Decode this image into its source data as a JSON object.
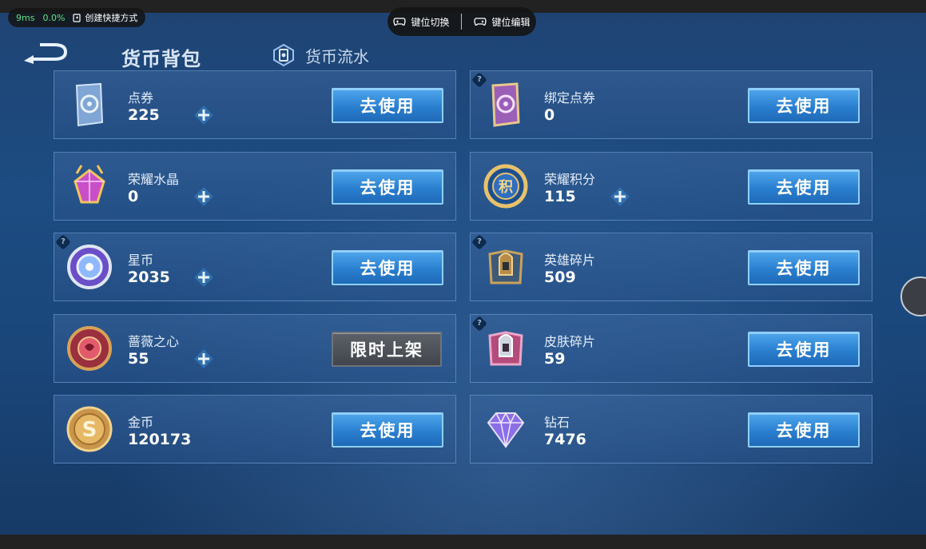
{
  "overlay": {
    "latency": "9ms",
    "load": "0.0%",
    "shortcut_label": "创建快捷方式",
    "key_switch": "键位切换",
    "key_edit": "键位编辑"
  },
  "header": {
    "title": "货币背包",
    "flow_tab": "货币流水"
  },
  "currencies": [
    {
      "name": "点券",
      "value": "225",
      "button": "去使用"
    },
    {
      "name": "绑定点券",
      "value": "0",
      "button": "去使用"
    },
    {
      "name": "荣耀水晶",
      "value": "0",
      "button": "去使用"
    },
    {
      "name": "荣耀积分",
      "value": "115",
      "button": "去使用"
    },
    {
      "name": "星币",
      "value": "2035",
      "button": "去使用"
    },
    {
      "name": "英雄碎片",
      "value": "509",
      "button": "去使用"
    },
    {
      "name": "蔷薇之心",
      "value": "55",
      "button": "限时上架"
    },
    {
      "name": "皮肤碎片",
      "value": "59",
      "button": "去使用"
    },
    {
      "name": "金币",
      "value": "120173",
      "button": "去使用"
    },
    {
      "name": "钻石",
      "value": "7476",
      "button": "去使用"
    }
  ],
  "colors": {
    "button_blue": "#2a7fcf",
    "button_disabled": "#42464c",
    "background": "#1c4c82"
  }
}
